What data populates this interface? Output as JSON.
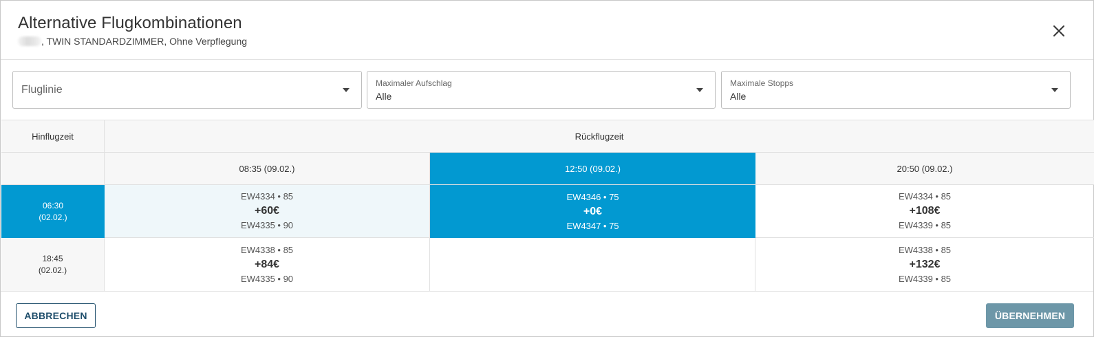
{
  "dialog": {
    "title": "Alternative Flugkombinationen",
    "subtitle": ", TWIN STANDARDZIMMER, Ohne Verpflegung",
    "close_icon": "close-icon"
  },
  "filters": {
    "airline": {
      "placeholder": "Fluglinie"
    },
    "surcharge": {
      "label": "Maximaler Aufschlag",
      "value": "Alle"
    },
    "stops": {
      "label": "Maximale Stopps",
      "value": "Alle"
    }
  },
  "table": {
    "outbound_header": "Hinflugzeit",
    "return_header": "Rückflugzeit",
    "return_times": [
      {
        "time": "08:35",
        "date": "(09.02.)"
      },
      {
        "time": "12:50",
        "date": "(09.02.)"
      },
      {
        "time": "20:50",
        "date": "(09.02.)"
      }
    ],
    "rows": [
      {
        "outbound_time": "06:30",
        "outbound_date": "(02.02.)",
        "combos": [
          {
            "out_flight": "EW4334 • 85",
            "price": "+60€",
            "ret_flight": "EW4335 • 90"
          },
          {
            "out_flight": "EW4346 • 75",
            "price": "+0€",
            "ret_flight": "EW4347 • 75"
          },
          {
            "out_flight": "EW4334 • 85",
            "price": "+108€",
            "ret_flight": "EW4339 • 85"
          }
        ]
      },
      {
        "outbound_time": "18:45",
        "outbound_date": "(02.02.)",
        "combos": [
          {
            "out_flight": "EW4338 • 85",
            "price": "+84€",
            "ret_flight": "EW4335 • 90"
          },
          {
            "out_flight": "",
            "price": "",
            "ret_flight": ""
          },
          {
            "out_flight": "EW4338 • 85",
            "price": "+132€",
            "ret_flight": "EW4339 • 85"
          }
        ]
      }
    ],
    "colors": {
      "selected": "#0299d1",
      "highlight": "#eff7fa",
      "header": "#f7f7f7"
    }
  },
  "footer": {
    "cancel_label": "ABBRECHEN",
    "apply_label": "ÜBERNEHMEN"
  }
}
